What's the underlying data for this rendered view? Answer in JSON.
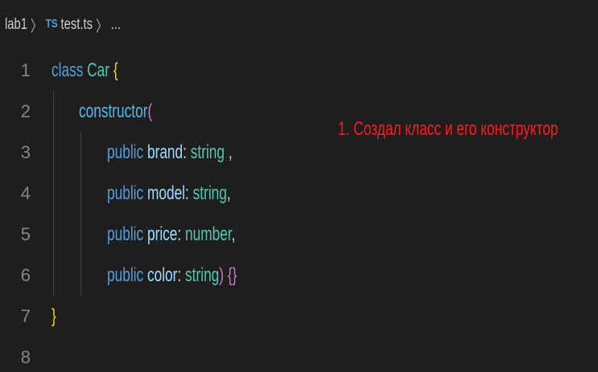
{
  "breadcrumb": {
    "folder": "lab1",
    "separator": "〉",
    "file_icon": "TS",
    "file_name": "test.ts",
    "ellipsis": "..."
  },
  "editor": {
    "line_numbers": [
      "1",
      "2",
      "3",
      "4",
      "5",
      "6",
      "7",
      "8"
    ],
    "tokens": {
      "class_kw": "class",
      "class_name": "Car",
      "open_brace": "{",
      "ctor": "constructor",
      "open_paren": "(",
      "public": "public",
      "brand": "brand",
      "model": "model",
      "price": "price",
      "color": "color",
      "colon": ":",
      "string": "string",
      "number": "number",
      "comma_spaced": " ,",
      "comma": ",",
      "close_paren": ")",
      "empty_open": "{",
      "empty_close": "}",
      "close_brace": "}"
    }
  },
  "annotation": "1. Создал класс и его конструктор",
  "colors": {
    "background": "#1e1e1e",
    "keyword": "#569cd6",
    "type": "#4ec9b0",
    "parameter": "#9cdcfe",
    "bracket_level1": "#ffd700",
    "bracket_level2": "#da70d6",
    "bracket_level3": "#179fff",
    "annotation": "#ff1a1a"
  }
}
